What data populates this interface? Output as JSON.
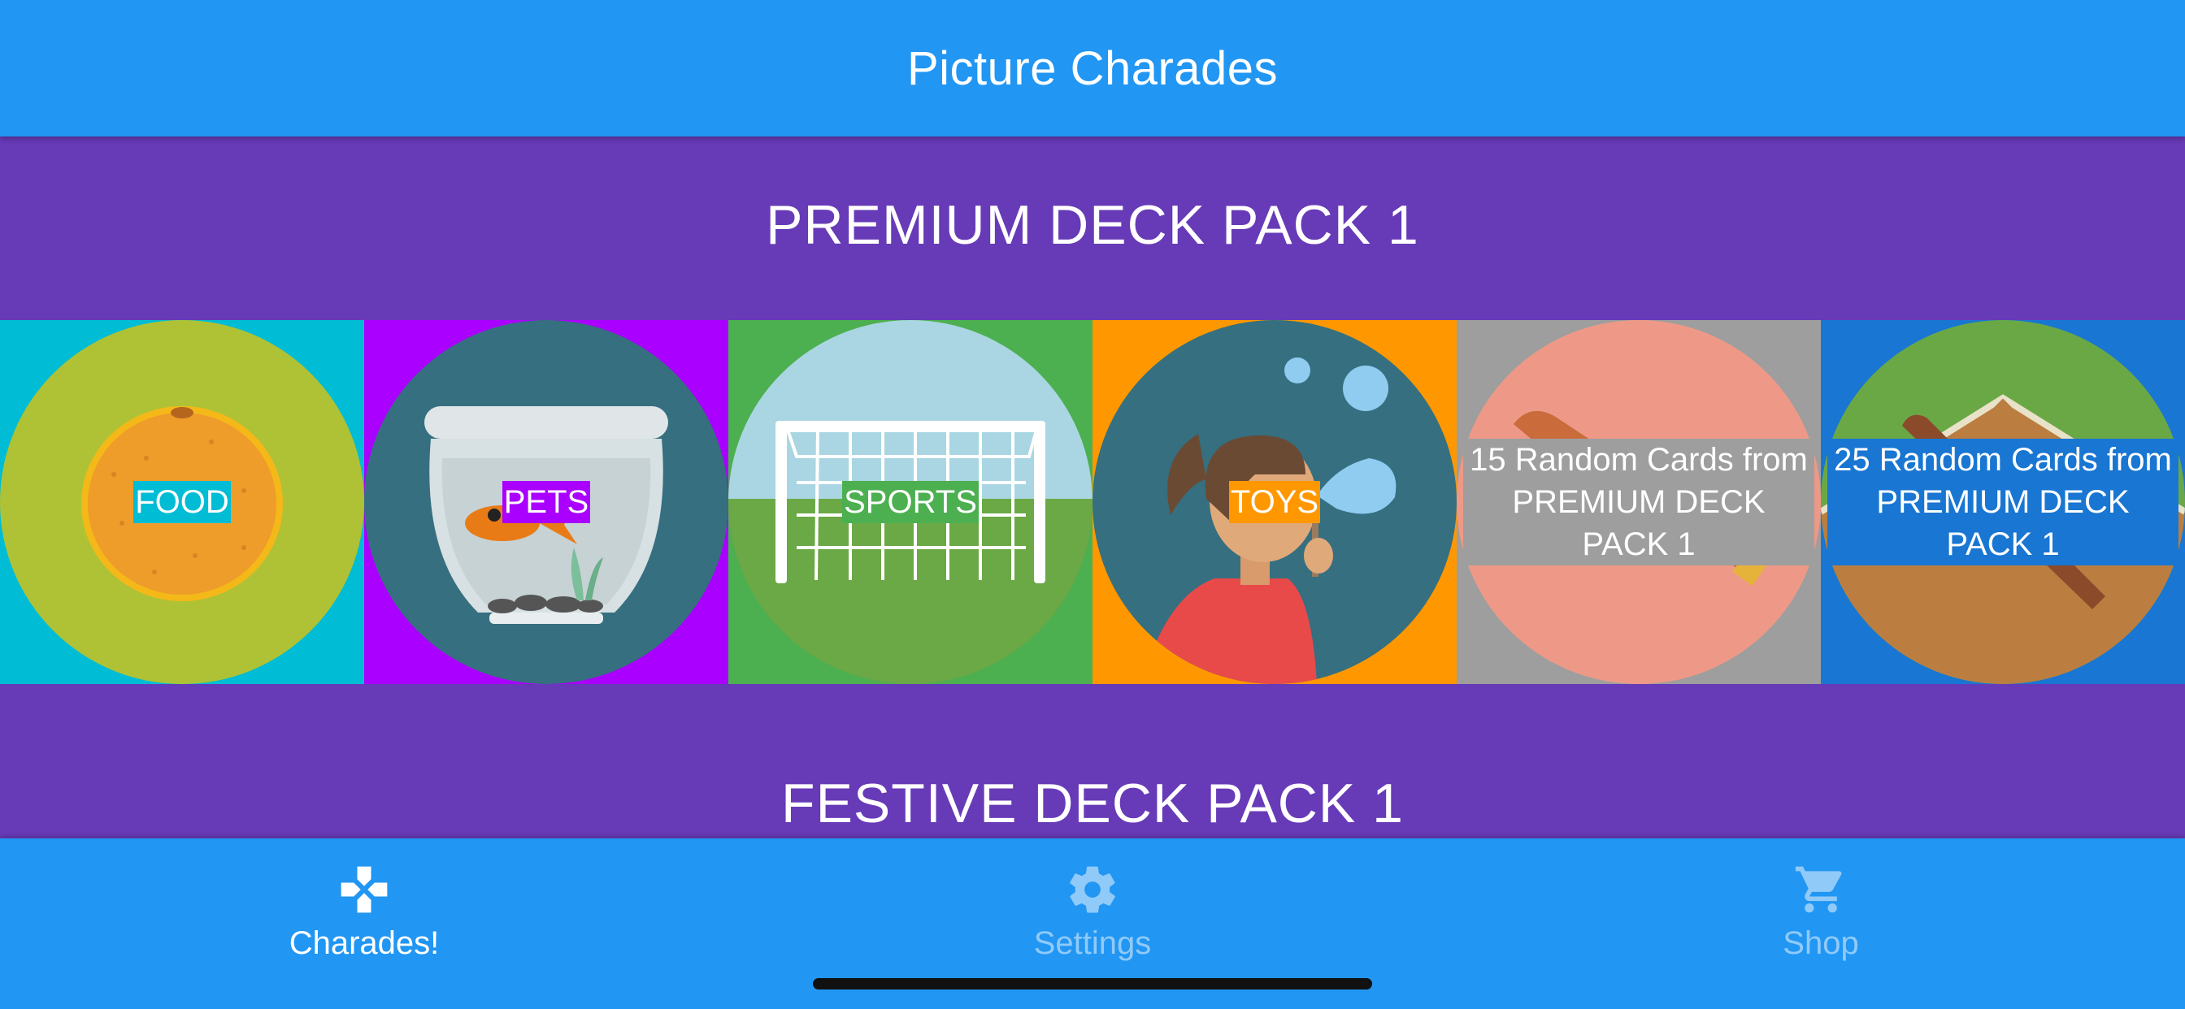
{
  "app": {
    "title": "Picture Charades"
  },
  "sections": [
    {
      "title": "PREMIUM DECK PACK 1",
      "decks": [
        {
          "label": "FOOD",
          "bg": "#00BCD4",
          "highlight": "#00BCD4",
          "icon": "orange-icon"
        },
        {
          "label": "PETS",
          "bg": "#AA00FF",
          "highlight": "#AA00FF",
          "icon": "fishbowl-icon"
        },
        {
          "label": "SPORTS",
          "bg": "#4CAF50",
          "highlight": "#4CAF50",
          "icon": "soccer-goal-icon"
        },
        {
          "label": "TOYS",
          "bg": "#FF9800",
          "highlight": "#FF9800",
          "icon": "girl-blowing-bubbles-icon"
        },
        {
          "label": "15 Random Cards from PREMIUM DECK PACK 1",
          "bg": "#9E9E9E",
          "highlight": "#9E9E9E",
          "icon": "baseball-bat-icon"
        },
        {
          "label": "25 Random Cards from PREMIUM DECK PACK 1",
          "bg": "#1976D2",
          "highlight": "#1976D2",
          "icon": "baseball-field-icon"
        }
      ]
    },
    {
      "title": "FESTIVE DECK PACK 1"
    }
  ],
  "tabs": [
    {
      "label": "Charades!",
      "icon": "gamepad-icon",
      "active": true
    },
    {
      "label": "Settings",
      "icon": "gear-icon",
      "active": false
    },
    {
      "label": "Shop",
      "icon": "cart-icon",
      "active": false
    }
  ],
  "colors": {
    "primary": "#2196F3",
    "section_bg": "#673AB7",
    "tab_active": "#FFFFFF",
    "tab_inactive": "#90CAF9"
  }
}
